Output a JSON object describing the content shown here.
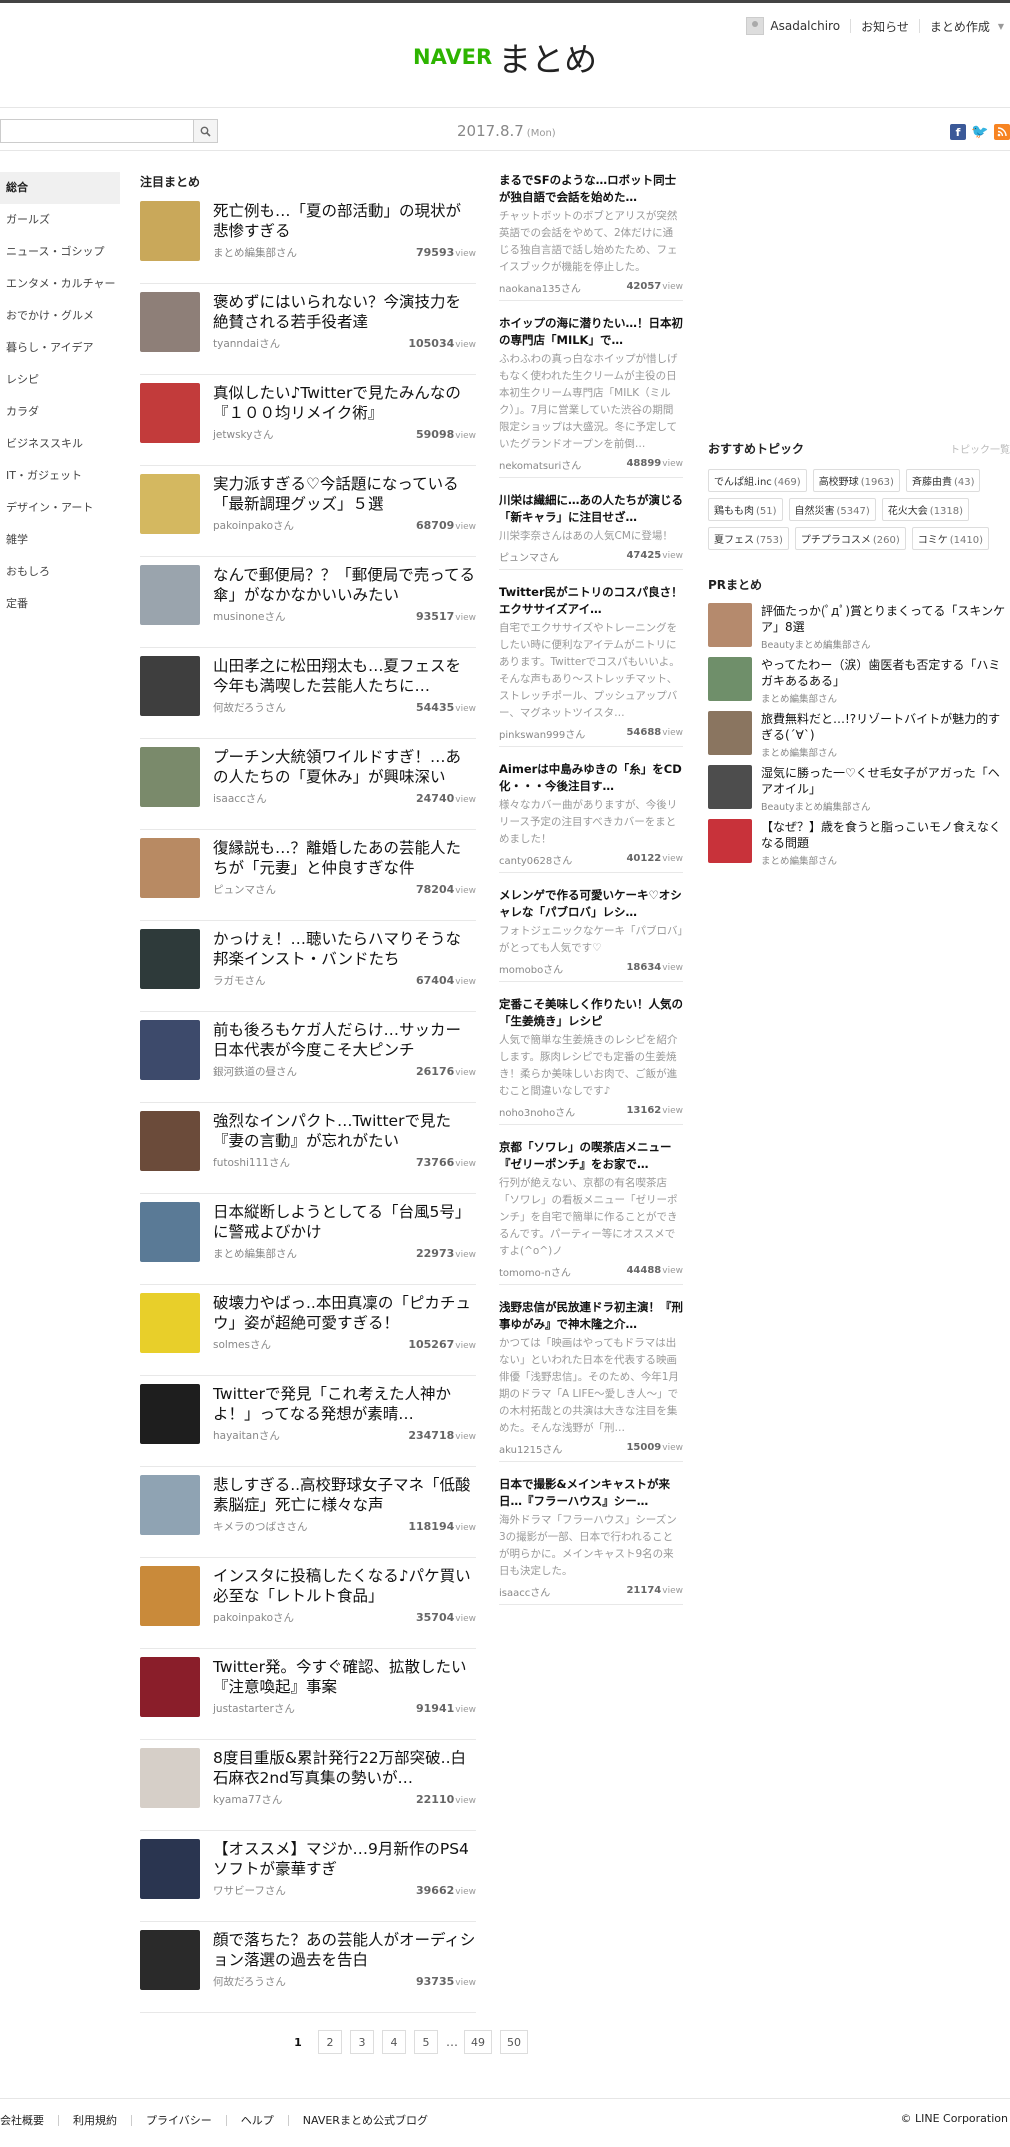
{
  "header": {
    "logo_naver": "NAVER",
    "logo_matome": "まとめ",
    "username": "Asadalchiro",
    "notifications": "お知らせ",
    "create": "まとめ作成"
  },
  "subbar": {
    "search_placeholder": "",
    "date": "2017.8.7",
    "day": "(Mon)"
  },
  "sidebar": {
    "items": [
      {
        "label": "総合"
      },
      {
        "label": "ガールズ"
      },
      {
        "label": "ニュース・ゴシップ"
      },
      {
        "label": "エンタメ・カルチャー"
      },
      {
        "label": "おでかけ・グルメ"
      },
      {
        "label": "暮らし・アイデア"
      },
      {
        "label": "レシピ"
      },
      {
        "label": "カラダ"
      },
      {
        "label": "ビジネススキル"
      },
      {
        "label": "IT・ガジェット"
      },
      {
        "label": "デザイン・アート"
      },
      {
        "label": "雑学"
      },
      {
        "label": "おもしろ"
      },
      {
        "label": "定番"
      }
    ]
  },
  "featured": {
    "heading": "注目まとめ",
    "view_unit": "view",
    "items": [
      {
        "title": "死亡例も…「夏の部活動」の現状が悲惨すぎる",
        "author": "まとめ編集部さん",
        "views": "79593",
        "color": "#c9a85a"
      },
      {
        "title": "褒めずにはいられない？今演技力を絶賛される若手役者達",
        "author": "tyanndaiさん",
        "views": "105034",
        "color": "#8e7f78"
      },
      {
        "title": "真似したい♪Twitterで見たみんなの『１００均リメイク術』",
        "author": "jetwskyさん",
        "views": "59098",
        "color": "#c23b3b"
      },
      {
        "title": "実力派すぎる♡今話題になっている「最新調理グッズ」５選",
        "author": "pakoinpakoさん",
        "views": "68709",
        "color": "#d4b860"
      },
      {
        "title": "なんで郵便局？？「郵便局で売ってる傘」がなかなかいいみたい",
        "author": "musinoneさん",
        "views": "93517",
        "color": "#9aa4ad"
      },
      {
        "title": "山田孝之に松田翔太も…夏フェスを今年も満喫した芸能人たちに…",
        "author": "何故だろうさん",
        "views": "54435",
        "color": "#3e3e3e"
      },
      {
        "title": "プーチン大統領ワイルドすぎ！…あの人たちの「夏休み」が興味深い",
        "author": "isaaccさん",
        "views": "24740",
        "color": "#7a8a6b"
      },
      {
        "title": "復縁説も…？離婚したあの芸能人たちが「元妻」と仲良すぎな件",
        "author": "ピュンマさん",
        "views": "78204",
        "color": "#b88a63"
      },
      {
        "title": "かっけぇ！…聴いたらハマりそうな邦楽インスト・バンドたち",
        "author": "ラガモさん",
        "views": "67404",
        "color": "#2e3a3a"
      },
      {
        "title": "前も後ろもケガ人だらけ…サッカー日本代表が今度こそ大ピンチ",
        "author": "銀河鉄道の昼さん",
        "views": "26176",
        "color": "#3d4a6b"
      },
      {
        "title": "強烈なインパクト…Twitterで見た『妻の言動』が忘れがたい",
        "author": "futoshi111さん",
        "views": "73766",
        "color": "#6b4b3a"
      },
      {
        "title": "日本縦断しようとしてる「台風5号」に警戒よびかけ",
        "author": "まとめ編集部さん",
        "views": "22973",
        "color": "#5a7a96"
      },
      {
        "title": "破壊力やばっ..本田真凜の「ピカチュウ」姿が超絶可愛すぎる！",
        "author": "solmesさん",
        "views": "105267",
        "color": "#e8cf2a"
      },
      {
        "title": "Twitterで発見「これ考えた人神かよ！」ってなる発想が素晴…",
        "author": "hayaitanさん",
        "views": "234718",
        "color": "#1e1e1e"
      },
      {
        "title": "悲しすぎる..高校野球女子マネ「低酸素脳症」死亡に様々な声",
        "author": "キメラのつばささん",
        "views": "118194",
        "color": "#8fa3b3"
      },
      {
        "title": "インスタに投稿したくなる♪パケ買い必至な「レトルト食品」",
        "author": "pakoinpakoさん",
        "views": "35704",
        "color": "#c98a3a"
      },
      {
        "title": "Twitter発。今すぐ確認、拡散したい『注意喚起』事案",
        "author": "justastarterさん",
        "views": "91941",
        "color": "#8a1e2a"
      },
      {
        "title": "8度目重版&累計発行22万部突破..白石麻衣2nd写真集の勢いが…",
        "author": "kyama77さん",
        "views": "22110",
        "color": "#d6cfc8"
      },
      {
        "title": "【オススメ】マジか…9月新作のPS4ソフトが豪華すぎ",
        "author": "ワサビーフさん",
        "views": "39662",
        "color": "#2a3550"
      },
      {
        "title": "顔で落ちた？あの芸能人がオーディション落選の過去を告白",
        "author": "何故だろうさん",
        "views": "93735",
        "color": "#2a2a2a"
      }
    ]
  },
  "column2": {
    "view_unit": "view",
    "items": [
      {
        "title": "まるでSFのような…ロボット同士が独自語で会話を始めた…",
        "desc": "チャットボットのボブとアリスが突然英語での会話をやめて、2体だけに通じる独自言語で話し始めたため、フェイスブックが機能を停止した。",
        "author": "naokana135さん",
        "views": "42057"
      },
      {
        "title": "ホイップの海に潜りたい…！日本初の専門店「MILK」で…",
        "desc": "ふわふわの真っ白なホイップが惜しげもなく使われた生クリームが主役の日本初生クリーム専門店「MILK（ミルク）」。7月に営業していた渋谷の期間限定ショップは大盛況。冬に予定していたグランドオープンを前倒…",
        "author": "nekomatsuriさん",
        "views": "48899"
      },
      {
        "title": "川栄は繊細に…あの人たちが演じる「新キャラ」に注目せざ…",
        "desc": "川栄李奈さんはあの人気CMに登場！",
        "author": "ピュンマさん",
        "views": "47425"
      },
      {
        "title": "Twitter民がニトリのコスパ良さ！エクササイズアイ…",
        "desc": "自宅でエクササイズやトレーニングをしたい時に便利なアイテムがニトリにあります。Twitterでコスパもいいよ。そんな声もあり〜ストレッチマット、ストレッチポール、プッシュアップバー、マグネットツイスタ…",
        "author": "pinkswan999さん",
        "views": "54688"
      },
      {
        "title": "Aimerは中島みゆきの「糸」をCD化・・・今後注目す…",
        "desc": "様々なカバー曲がありますが、今後リリース予定の注目すべきカバーをまとめました！",
        "author": "canty0628さん",
        "views": "40122"
      },
      {
        "title": "メレンゲで作る可愛いケーキ♡オシャレな「パブロバ」レシ…",
        "desc": "フォトジェニックなケーキ「パブロバ」がとっても人気です♡",
        "author": "momoboさん",
        "views": "18634"
      },
      {
        "title": "定番こそ美味しく作りたい！人気の「生姜焼き」レシピ",
        "desc": "人気で簡単な生姜焼きのレシピを紹介します。豚肉レシピでも定番の生姜焼き！柔らか美味しいお肉で、ご飯が進むこと間違いなしです♪",
        "author": "noho3nohoさん",
        "views": "13162"
      },
      {
        "title": "京都「ソワレ」の喫茶店メニュー『ゼリーポンチ』をお家で…",
        "desc": "行列が絶えない、京都の有名喫茶店「ソワレ」の看板メニュー「ゼリーポンチ」を自宅で簡単に作ることができるんです。パーティー等にオススメですよ(^o^)ノ",
        "author": "tomomo-nさん",
        "views": "44488"
      },
      {
        "title": "浅野忠信が民放連ドラ初主演！『刑事ゆがみ』で神木隆之介…",
        "desc": "かつては「映画はやってもドラマは出ない」といわれた日本を代表する映画俳優「浅野忠信」。そのため、今年1月期のドラマ「A LIFE〜愛しき人〜」での木村拓哉との共演は大きな注目を集めた。そんな浅野が「刑…",
        "author": "aku1215さん",
        "views": "15009"
      },
      {
        "title": "日本で撮影&メインキャストが来日…『フラーハウス』シー…",
        "desc": "海外ドラマ「フラーハウス」シーズン3の撮影が一部、日本で行われることが明らかに。メインキャスト9名の来日も決定した。",
        "author": "isaaccさん",
        "views": "21174"
      }
    ]
  },
  "topics": {
    "heading": "おすすめトピック",
    "more": "トピック一覧",
    "tags": [
      {
        "name": "でんぱ組.inc",
        "count": "(469)"
      },
      {
        "name": "高校野球",
        "count": "(1963)"
      },
      {
        "name": "斉藤由貴",
        "count": "(43)"
      },
      {
        "name": "鶏もも肉",
        "count": "(51)"
      },
      {
        "name": "自然災害",
        "count": "(5347)"
      },
      {
        "name": "花火大会",
        "count": "(1318)"
      },
      {
        "name": "夏フェス",
        "count": "(753)"
      },
      {
        "name": "プチプラコスメ",
        "count": "(260)"
      },
      {
        "name": "コミケ",
        "count": "(1410)"
      }
    ]
  },
  "pr": {
    "heading": "PRまとめ",
    "items": [
      {
        "title": "評価たっか(ﾟдﾟ)賞とりまくってる「スキンケア」8選",
        "author": "Beautyまとめ編集部さん",
        "color": "#b58a6d"
      },
      {
        "title": "やってたわー（涙）歯医者も否定する「ハミガキあるある」",
        "author": "まとめ編集部さん",
        "color": "#6f8f6a"
      },
      {
        "title": "旅費無料だと…!?リゾートバイトが魅力的すぎる(´∀`)",
        "author": "まとめ編集部さん",
        "color": "#8a7560"
      },
      {
        "title": "湿気に勝った一♡くせ毛女子がアガった「ヘアオイル」",
        "author": "Beautyまとめ編集部さん",
        "color": "#4d4d4d"
      },
      {
        "title": "【なぜ？】歳を食うと脂っこいモノ食えなくなる問題",
        "author": "まとめ編集部さん",
        "color": "#c8323a"
      }
    ]
  },
  "pager": {
    "current": "1",
    "pages": [
      "2",
      "3",
      "4",
      "5"
    ],
    "dots": "…",
    "more": [
      "49",
      "50"
    ]
  },
  "footer": {
    "links": [
      "会社概要",
      "利用規約",
      "プライバシー",
      "ヘルプ",
      "NAVERまとめ公式ブログ"
    ],
    "copyright": "© LINE Corporation"
  }
}
